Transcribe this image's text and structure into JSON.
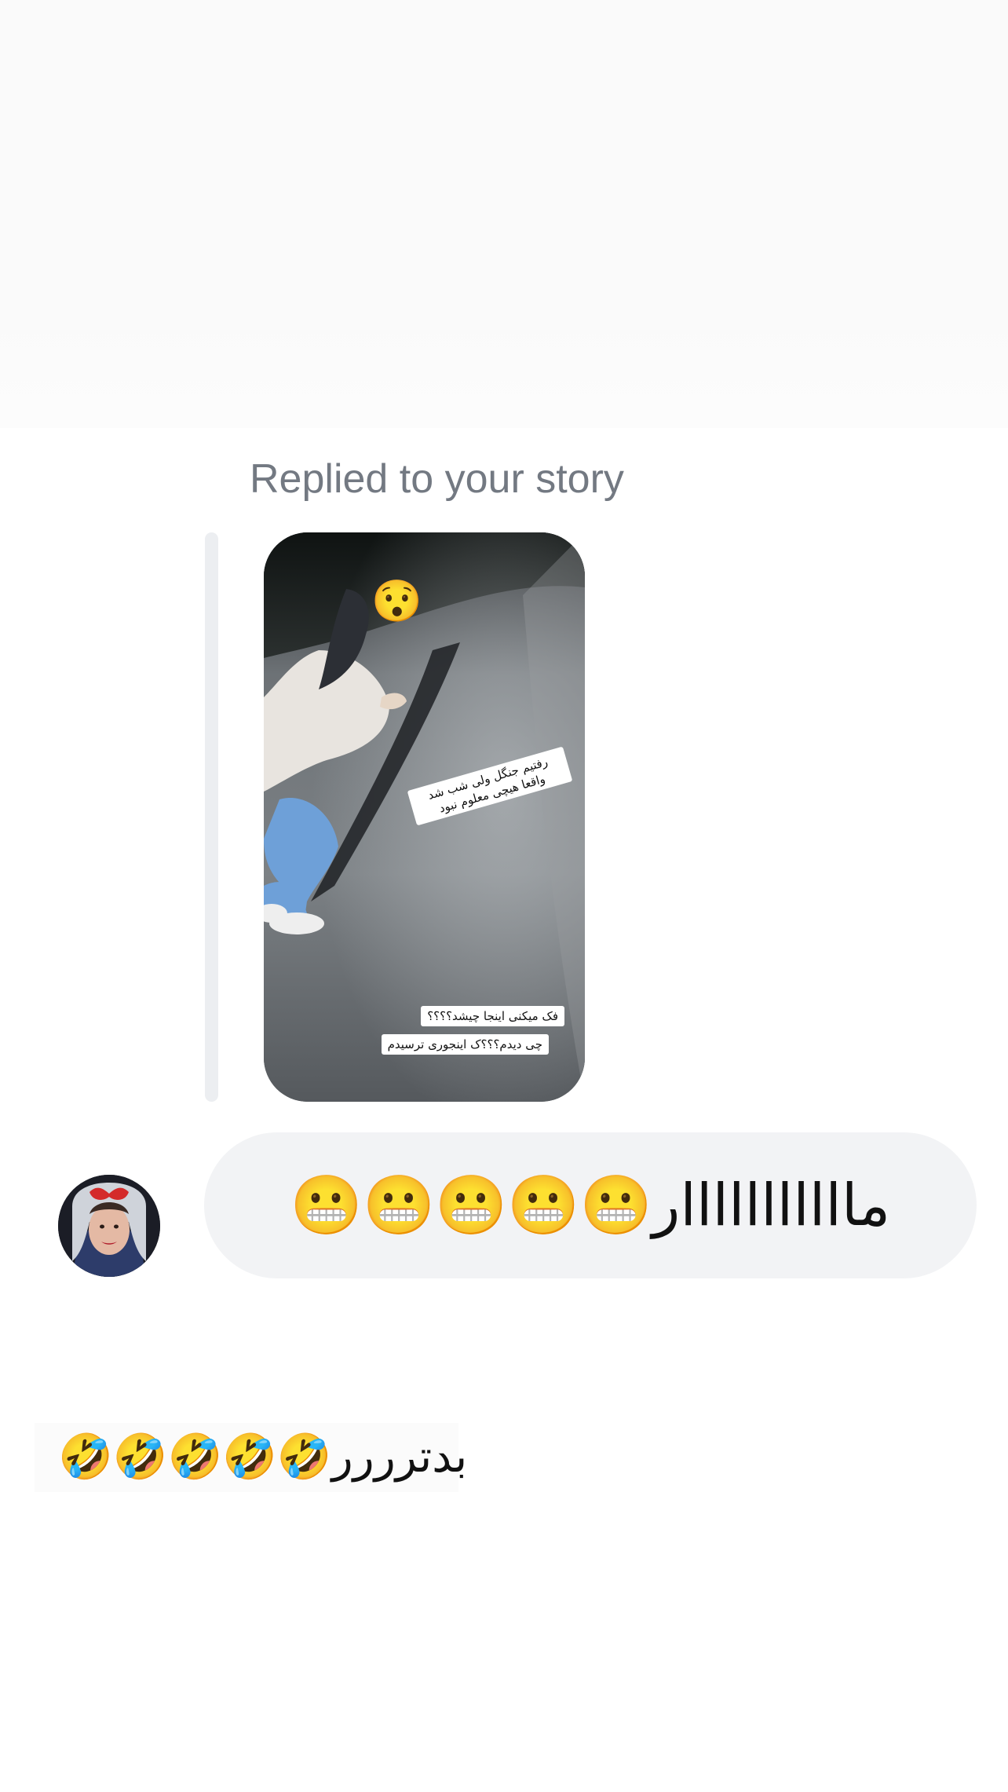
{
  "thread": {
    "story_reply_label": "Replied to your story"
  },
  "story_preview": {
    "emoji": "😯",
    "caption_1": "رفتیم جنگل ولی شب شد واقعا هیچی معلوم نبود",
    "caption_2": "فک میکنی اینجا چیشد؟؟؟؟",
    "caption_3": "چی دیدم؟؟؟ک اینجوری ترسیدم"
  },
  "received_message": {
    "text": "مااااااااااار😬😬😬😬😬"
  },
  "sent_message": {
    "text": "بدترررر🤣🤣🤣🤣🤣"
  },
  "colors": {
    "label_gray": "#737982",
    "bubble_bg": "#f2f3f5",
    "reply_bar": "#eceef1",
    "text": "#111111"
  }
}
